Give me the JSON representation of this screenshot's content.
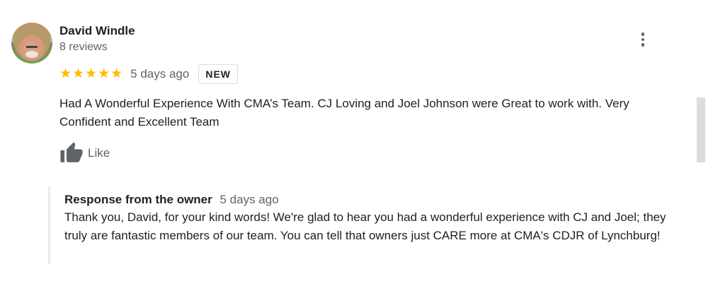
{
  "reviewer": {
    "name": "David Windle",
    "reviews_count": "8 reviews",
    "avatar_icon": "profile-photo"
  },
  "review": {
    "stars": "★★★★★",
    "rating": 5,
    "date": "5 days ago",
    "badge": "NEW",
    "text": "Had A Wonderful Experience With CMA’s Team. CJ Loving and Joel Johnson were Great to work with. Very Confident and Excellent Team",
    "like_label": "Like"
  },
  "owner_response": {
    "title": "Response from the owner",
    "date": "5 days ago",
    "text": "Thank you, David, for your kind words! We're glad to hear you had a wonderful experience with CJ and Joel; they truly are fantastic members of our team. You can tell that owners just CARE more at CMA's CDJR of Lynchburg!"
  },
  "colors": {
    "star": "#fbbc04",
    "secondary_text": "#5f6368",
    "primary_text": "#202124"
  },
  "icons": {
    "more": "more-vert-icon",
    "like": "thumb-up-icon"
  }
}
